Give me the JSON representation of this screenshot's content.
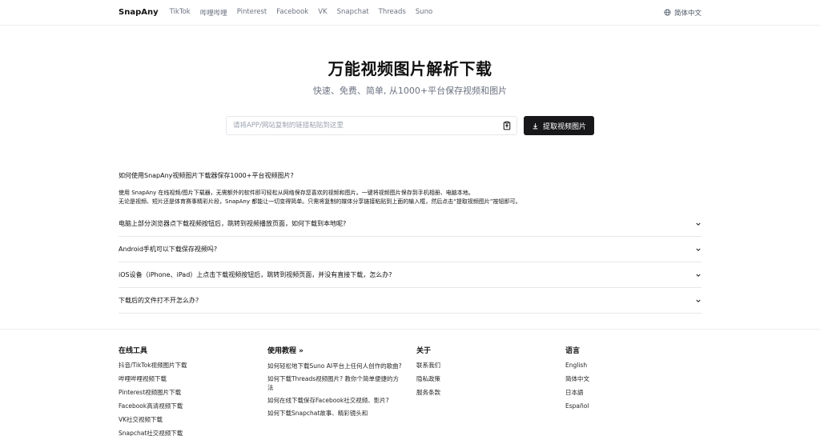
{
  "header": {
    "brand": "SnapAny",
    "nav": [
      "TikTok",
      "哔哩哔哩",
      "Pinterest",
      "Facebook",
      "VK",
      "Snapchat",
      "Threads",
      "Suno"
    ],
    "language": "简体中文"
  },
  "hero": {
    "title": "万能视频图片解析下载",
    "subtitle": "快速、免费、简单, 从1000+平台保存视频和图片"
  },
  "search": {
    "placeholder": "请将APP/网站复制的链接粘贴到这里",
    "value": "",
    "submit_label": "提取视频图片"
  },
  "faq": {
    "title": "如何使用SnapAny视频图片下载器保存1000+平台视频图片?",
    "desc_line1": "使用 SnapAny 在线视频/图片下载器，无需额外的软件即可轻松从网络保存您喜欢的视频和图片。一键将视频图片保存到手机相册、电脑本地。",
    "desc_line2": "无论是视频、短片还是体育赛事精彩片段，SnapAny 都能让一切变得简单。只需将复制的媒体分享链接粘贴到上面的输入框，然后点击“提取视频图片”按钮即可。",
    "items": [
      "电脑上部分浏览器点下载视频按钮后，跳转到视频播放页面，如何下载到本地呢?",
      "Android手机可以下载保存视频吗?",
      "iOS设备（iPhone、iPad）上点击下载视频按钮后，跳转到视频页面，并没有直接下载，怎么办?",
      "下载后的文件打不开怎么办?"
    ]
  },
  "footer": {
    "tools": {
      "title": "在线工具",
      "links": [
        "抖音/TikTok视频图片下载",
        "哔哩哔哩视频下载",
        "Pinterest视频图片下载",
        "Facebook高清视频下载",
        "VK社交视频下载",
        "Snapchat社交视频下载"
      ]
    },
    "tutorials": {
      "title": "使用教程 »",
      "links": [
        "如何轻松地下载Suno AI平台上任何人创作的歌曲?",
        "如何下载Threads视频图片? 教你个简单便捷的方法",
        "如何在线下载保存Facebook社交视频、影片?",
        "如何下载Snapchat故事、精彩镜头和"
      ]
    },
    "about": {
      "title": "关于",
      "links": [
        "联系我们",
        "隐私政策",
        "服务条款"
      ]
    },
    "language": {
      "title": "语言",
      "links": [
        "English",
        "简体中文",
        "日本語",
        "Español"
      ]
    }
  }
}
